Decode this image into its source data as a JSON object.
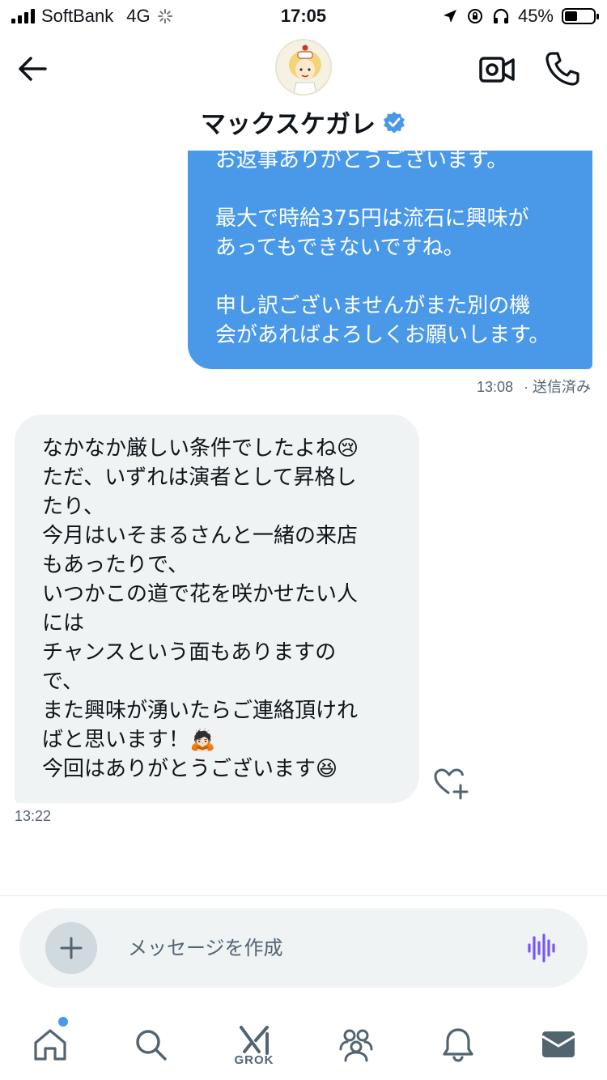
{
  "status_bar": {
    "carrier": "SoftBank",
    "network": "4G",
    "time": "17:05",
    "battery": "45%",
    "battery_level": 0.45
  },
  "header": {
    "back_icon": "arrow-left-icon",
    "name": "マックスケガレ",
    "verified_icon": "verified-badge-icon",
    "video_icon": "video-camera-icon",
    "call_icon": "phone-icon"
  },
  "messages": {
    "outgoing": {
      "paragraphs": [
        "お返事ありがとうございます。",
        "最大で時給375円は流石に興味が\nあってもできないですね。",
        "申し訳ございませんがまた別の機\n会があればよろしくお願いします。"
      ],
      "time": "13:08",
      "status": "· 送信済み"
    },
    "incoming": {
      "text": "なかなか厳しい条件でしたよね😢\nただ、いずれは演者として昇格し\nたり、\n今月はいそまるさんと一緒の来店\nもあったりで、\nいつかこの道で花を咲かせたい人\nには\nチャンスという面もありますの\nで、\nまた興味が湧いたらご連絡頂けれ\nばと思います！🙇🏻\n今回はありがとうございます😆",
      "time": "13:22",
      "reaction_icon": "heart-plus-icon"
    }
  },
  "composer": {
    "placeholder": "メッセージを作成",
    "add_icon": "plus-icon",
    "voice_icon": "voice-wave-icon"
  },
  "tabbar": {
    "grok_label": "GROK",
    "icons": [
      "home-icon",
      "search-icon",
      "grok-icon",
      "communities-icon",
      "notifications-icon",
      "messages-icon"
    ]
  },
  "colors": {
    "accent": "#4a99e9",
    "bubble_in": "#eff3f4",
    "muted_text": "#536471",
    "grok_purple": "#7856ff"
  }
}
